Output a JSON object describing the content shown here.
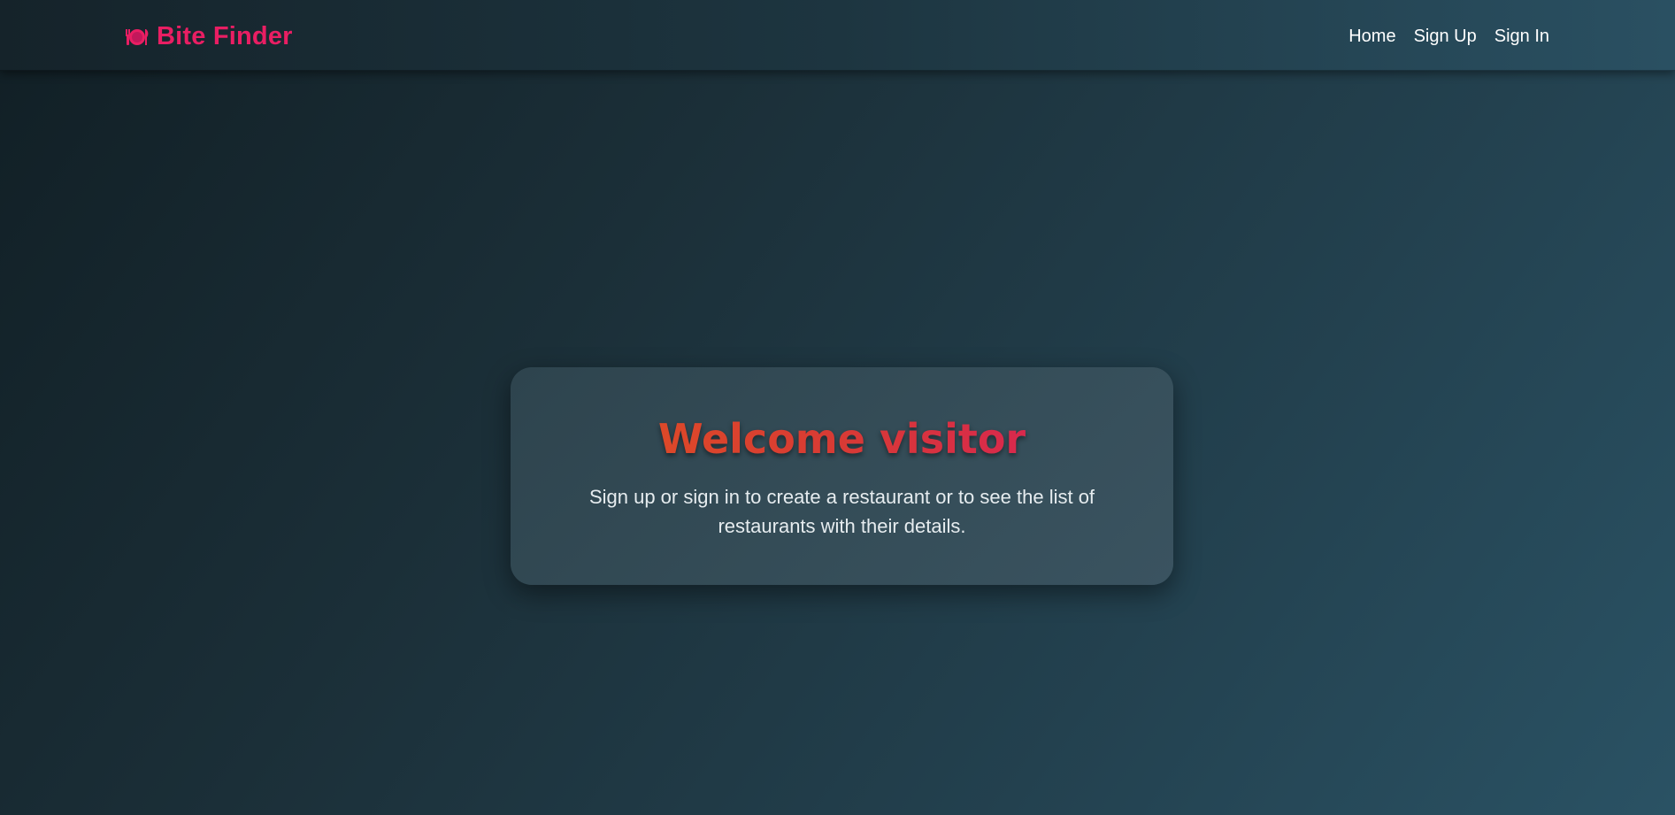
{
  "navbar": {
    "brand": {
      "icon": "plate-cutlery-icon",
      "label": "Bite Finder",
      "color": "#e91e63"
    },
    "links": [
      {
        "label": "Home"
      },
      {
        "label": "Sign Up"
      },
      {
        "label": "Sign In"
      }
    ]
  },
  "welcome": {
    "title": "Welcome visitor",
    "text": "Sign up or sign in to create a restaurant or to see the list of restaurants with their details."
  },
  "colors": {
    "accent": "#e91e63",
    "title_gradient_start": "#e0541f",
    "title_gradient_end": "#d81b60"
  }
}
